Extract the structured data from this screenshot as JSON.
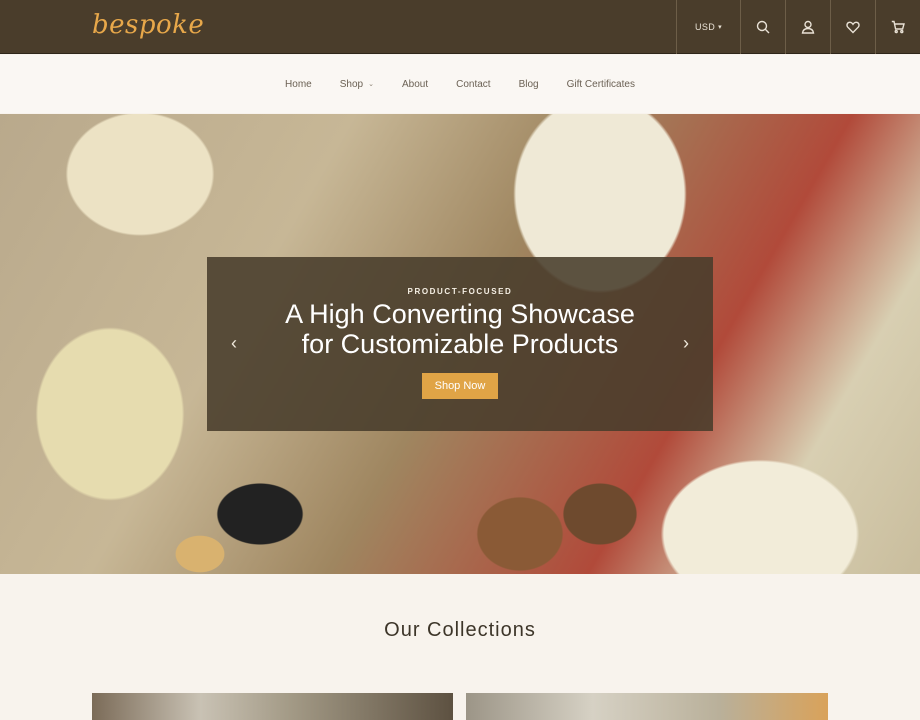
{
  "header": {
    "logo": "bespoke",
    "currency": "USD",
    "icons": [
      "search-icon",
      "user-icon",
      "heart-icon",
      "cart-icon"
    ],
    "colors": {
      "bar": "#4a3d2b",
      "logo": "#e8a84a"
    }
  },
  "nav": {
    "items": [
      {
        "label": "Home"
      },
      {
        "label": "Shop",
        "has_dropdown": true
      },
      {
        "label": "About"
      },
      {
        "label": "Contact"
      },
      {
        "label": "Blog"
      },
      {
        "label": "Gift Certificates"
      }
    ]
  },
  "hero": {
    "kicker": "PRODUCT-FOCUSED",
    "title_line1": "A High Converting Showcase",
    "title_line2": "for Customizable Products",
    "button_label": "Shop Now",
    "button_color": "#e0a446",
    "prev_icon": "chevron-left-icon",
    "next_icon": "chevron-right-icon"
  },
  "collections": {
    "title": "Our Collections"
  }
}
